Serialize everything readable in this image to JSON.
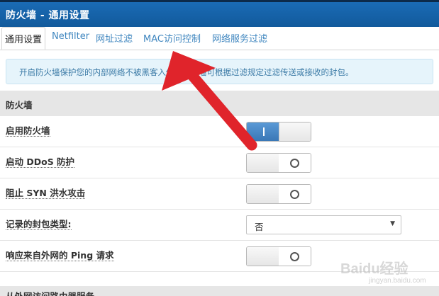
{
  "header": {
    "title": "防火墙 - 通用设置"
  },
  "tabs": [
    {
      "label": "通用设置",
      "active": true
    },
    {
      "label": "Netfilter"
    },
    {
      "label": "网址过滤"
    },
    {
      "label": "MAC访问控制"
    },
    {
      "label": "网络服务过滤"
    }
  ],
  "alert": {
    "text": "开启防火墙保护您的内部网络不被黑客入侵。防火墙可根据过滤规定过滤传送或接收的封包。"
  },
  "section": {
    "title": "防火墙"
  },
  "rows": [
    {
      "label": "启用防火墙",
      "control": "switch",
      "state": "on"
    },
    {
      "label": "启动 DDoS 防护",
      "control": "switch",
      "state": "off"
    },
    {
      "label": "阻止 SYN 洪水攻击",
      "control": "switch",
      "state": "off"
    },
    {
      "label": "记录的封包类型:",
      "control": "select",
      "value": "否"
    },
    {
      "label": "响应来自外网的 Ping 请求",
      "control": "switch",
      "state": "off"
    }
  ],
  "next_section": {
    "title": "从外网访问路由器服务"
  },
  "watermark": {
    "brand": "Baidu经验",
    "sub": "jingyan.baidu.com"
  },
  "colors": {
    "header_bg": "#1a6bb5",
    "accent": "#3f86bf",
    "switch_on": "#4a8ac6",
    "arrow": "#e0242b"
  }
}
